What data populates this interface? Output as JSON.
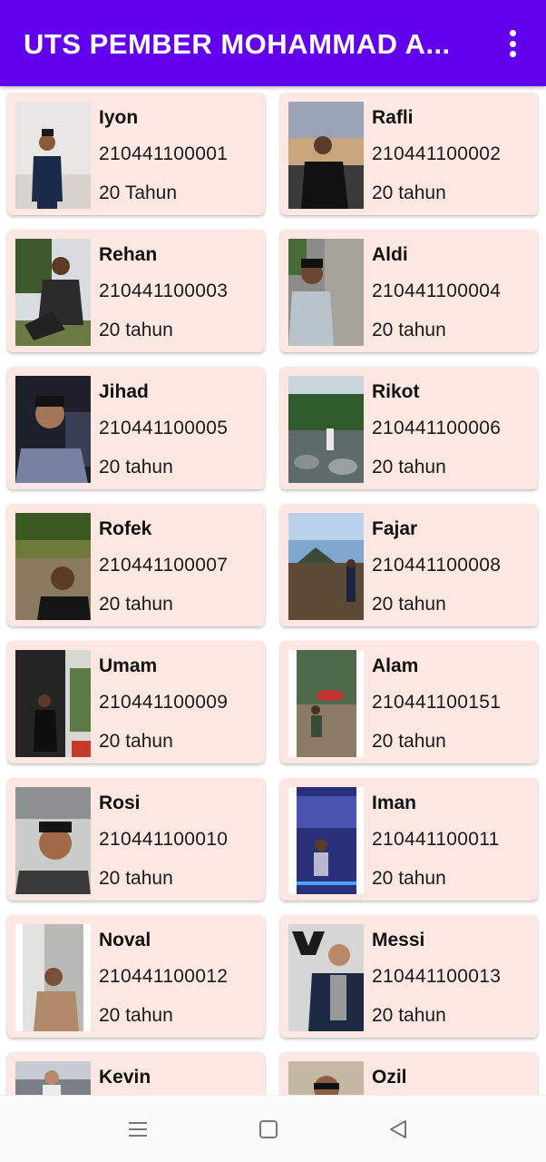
{
  "app_bar": {
    "title": "UTS PEMBER MOHAMMAD A...",
    "overflow_icon": "more-vert-icon",
    "background": "#6200ee"
  },
  "card_background": "#fde7e2",
  "students": [
    {
      "name": "Iyon",
      "nim": "210441100001",
      "age": "20 Tahun"
    },
    {
      "name": "Rafli",
      "nim": "210441100002",
      "age": "20 tahun"
    },
    {
      "name": "Rehan",
      "nim": "210441100003",
      "age": "20 tahun"
    },
    {
      "name": "Aldi",
      "nim": "210441100004",
      "age": "20 tahun"
    },
    {
      "name": "Jihad",
      "nim": "210441100005",
      "age": "20 tahun"
    },
    {
      "name": "Rikot",
      "nim": "210441100006",
      "age": "20 tahun"
    },
    {
      "name": "Rofek",
      "nim": "210441100007",
      "age": "20 tahun"
    },
    {
      "name": "Fajar",
      "nim": "210441100008",
      "age": "20 tahun"
    },
    {
      "name": "Umam",
      "nim": "210441100009",
      "age": "20 tahun"
    },
    {
      "name": "Alam",
      "nim": "210441100151",
      "age": "20 tahun"
    },
    {
      "name": "Rosi",
      "nim": "210441100010",
      "age": "20 tahun"
    },
    {
      "name": "Iman",
      "nim": "210441100011",
      "age": "20 tahun"
    },
    {
      "name": "Noval",
      "nim": "210441100012",
      "age": "20 tahun"
    },
    {
      "name": "Messi",
      "nim": "210441100013",
      "age": "20 tahun"
    },
    {
      "name": "Kevin",
      "nim": "",
      "age": ""
    },
    {
      "name": "Ozil",
      "nim": "",
      "age": ""
    }
  ],
  "nav_bar": {
    "buttons": [
      "menu-icon",
      "home-icon",
      "back-icon"
    ]
  }
}
